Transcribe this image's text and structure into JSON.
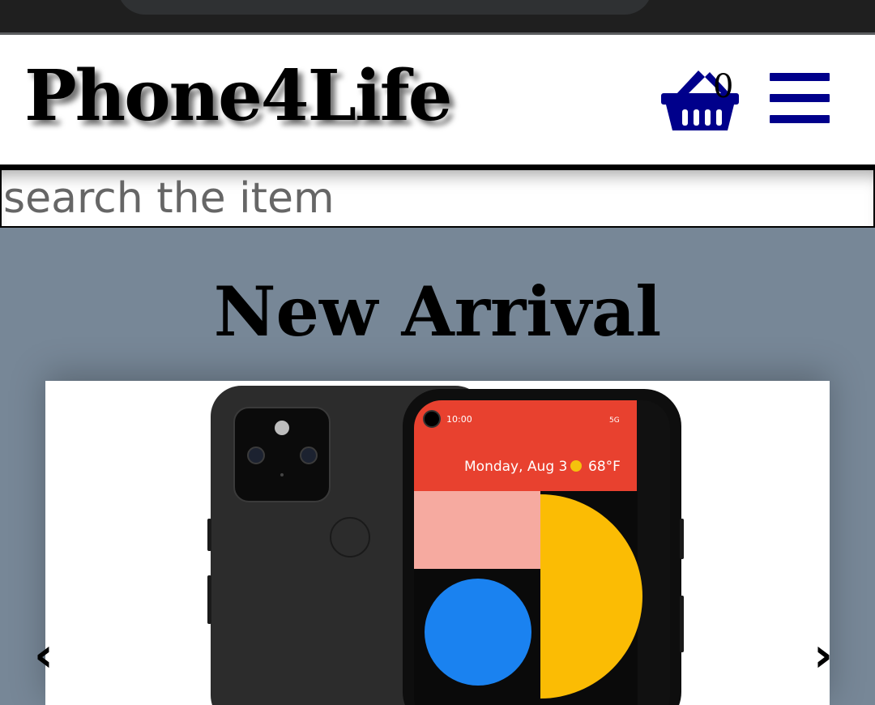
{
  "header": {
    "brand": "Phone4Life",
    "cart_count": "0"
  },
  "search": {
    "placeholder": "search the item"
  },
  "main": {
    "section_title": "New Arrival",
    "prev_label": "‹",
    "next_label": "›"
  },
  "product_screen": {
    "time": "10:00",
    "network": "5G",
    "date_weather": "Monday, Aug 3",
    "temperature": "68°F"
  },
  "icons": {
    "cart": "basket-icon",
    "menu": "hamburger-menu-icon",
    "prev": "chevron-left-icon",
    "next": "chevron-right-icon"
  },
  "colors": {
    "brand_icon": "#00008b",
    "page_bg": "#778797",
    "header_bg": "#ffffff"
  }
}
